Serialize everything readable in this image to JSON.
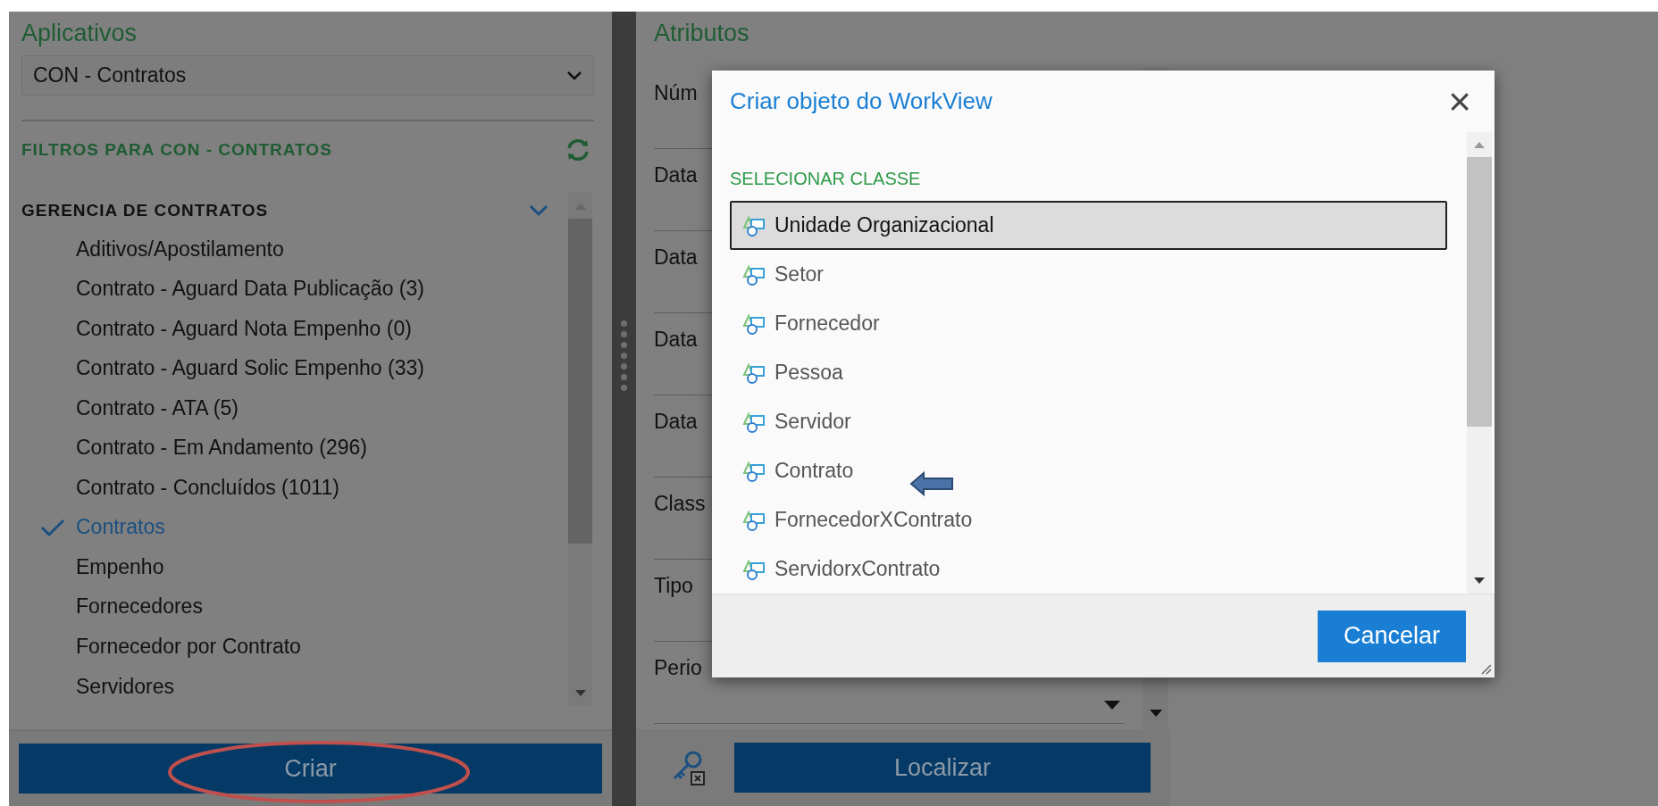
{
  "apps_panel": {
    "title": "Aplicativos",
    "select_value": "CON - Contratos",
    "filters_title": "FILTROS PARA CON - CONTRATOS",
    "group": {
      "label": "GERENCIA DE CONTRATOS",
      "expanded": true
    },
    "filters": [
      {
        "label": "Aditivos/Apostilamento",
        "selected": false
      },
      {
        "label": "Contrato - Aguard Data Publicação (3)",
        "selected": false
      },
      {
        "label": "Contrato - Aguard Nota Empenho (0)",
        "selected": false
      },
      {
        "label": "Contrato - Aguard Solic Empenho (33)",
        "selected": false
      },
      {
        "label": "Contrato - ATA (5)",
        "selected": false
      },
      {
        "label": "Contrato - Em Andamento (296)",
        "selected": false
      },
      {
        "label": "Contrato - Concluídos (1011)",
        "selected": false
      },
      {
        "label": "Contratos",
        "selected": true
      },
      {
        "label": "Empenho",
        "selected": false
      },
      {
        "label": "Fornecedores",
        "selected": false
      },
      {
        "label": "Fornecedor por Contrato",
        "selected": false
      },
      {
        "label": "Servidores",
        "selected": false
      }
    ],
    "create_button": "Criar"
  },
  "attributes_panel": {
    "title": "Atributos",
    "fields": [
      {
        "label": "Núm",
        "kind": "text"
      },
      {
        "label": "Data",
        "kind": "text"
      },
      {
        "label": "Data",
        "kind": "text"
      },
      {
        "label": "Data",
        "kind": "text"
      },
      {
        "label": "Data",
        "kind": "text"
      },
      {
        "label": "Class",
        "kind": "text"
      },
      {
        "label": "Tipo",
        "kind": "text"
      },
      {
        "label": "Perio",
        "kind": "select"
      }
    ],
    "search_button": "Localizar"
  },
  "dialog": {
    "title": "Criar objeto do WorkView",
    "close": "×",
    "section": "SELECIONAR CLASSE",
    "classes": [
      {
        "label": "Unidade Organizacional",
        "selected": true
      },
      {
        "label": "Setor",
        "selected": false
      },
      {
        "label": "Fornecedor",
        "selected": false
      },
      {
        "label": "Pessoa",
        "selected": false
      },
      {
        "label": "Servidor",
        "selected": false
      },
      {
        "label": "Contrato",
        "selected": false
      },
      {
        "label": "FornecedorXContrato",
        "selected": false
      },
      {
        "label": "ServidorxContrato",
        "selected": false
      }
    ],
    "cancel_button": "Cancelar"
  }
}
